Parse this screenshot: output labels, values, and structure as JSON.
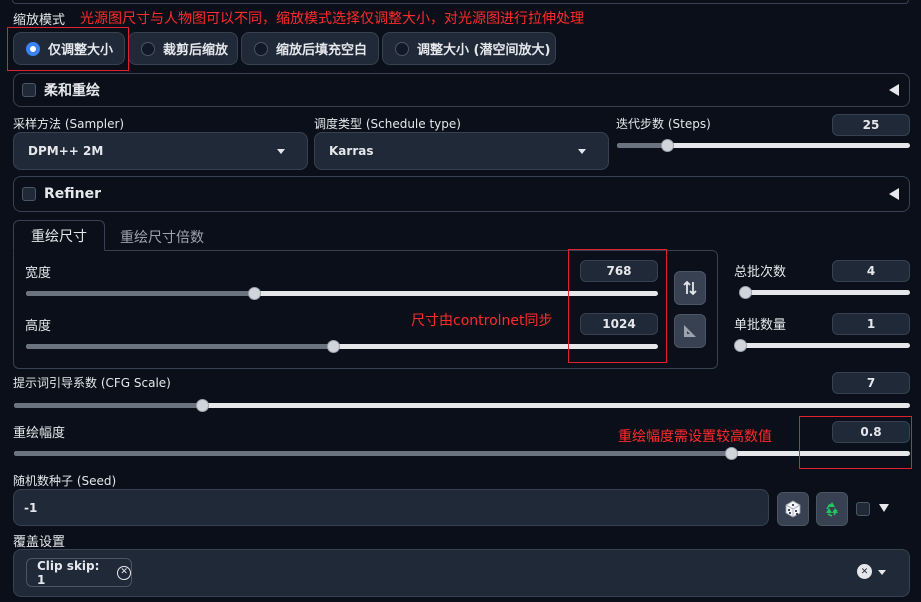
{
  "resize": {
    "label": "缩放模式",
    "options": [
      "仅调整大小",
      "裁剪后缩放",
      "缩放后填充空白",
      "调整大小 (潜空间放大)"
    ],
    "selected_index": 0
  },
  "annotations": {
    "resize_note": "光源图尺寸与人物图可以不同，缩放模式选择仅调整大小，对光源图进行拉伸处理",
    "size_note": "尺寸由controlnet同步",
    "denoise_note": "重绘幅度需设置较高数值"
  },
  "soft_inpaint": {
    "label": "柔和重绘"
  },
  "sampler": {
    "label": "采样方法 (Sampler)",
    "value": "DPM++ 2M"
  },
  "schedule": {
    "label": "调度类型 (Schedule type)",
    "value": "Karras"
  },
  "steps": {
    "label": "迭代步数 (Steps)",
    "value": "25",
    "fraction": 0.17
  },
  "refiner": {
    "label": "Refiner"
  },
  "tabs": [
    "重绘尺寸",
    "重绘尺寸倍数"
  ],
  "width": {
    "label": "宽度",
    "value": "768",
    "fraction": 0.36
  },
  "height": {
    "label": "高度",
    "value": "1024",
    "fraction": 0.485
  },
  "batch_count": {
    "label": "总批次数",
    "value": "4",
    "fraction": 0.03
  },
  "batch_size": {
    "label": "单批数量",
    "value": "1",
    "fraction": 0.0
  },
  "cfg": {
    "label": "提示词引导系数 (CFG Scale)",
    "value": "7",
    "fraction": 0.21
  },
  "denoise": {
    "label": "重绘幅度",
    "value": "0.8",
    "fraction": 0.8
  },
  "seed": {
    "label": "随机数种子 (Seed)",
    "value": "-1"
  },
  "override": {
    "label": "覆盖设置",
    "chip": "Clip skip: 1"
  },
  "colors": {
    "accent": "#3b82f6",
    "annotation": "#ff2a2a",
    "recycle": "#22c55e"
  }
}
